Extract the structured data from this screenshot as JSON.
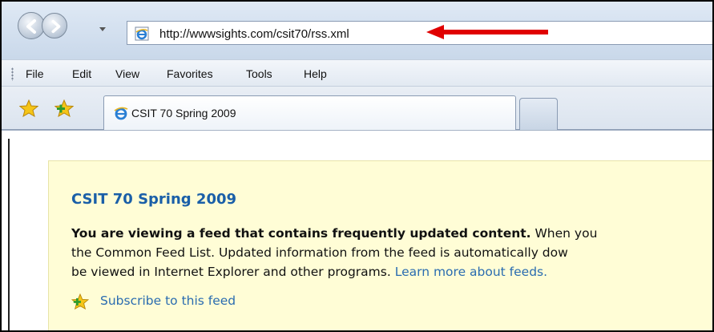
{
  "address_bar": {
    "url": "http://wwwsights.com/csit70/rss.xml"
  },
  "menu": {
    "items": [
      "File",
      "Edit",
      "View",
      "Favorites",
      "Tools",
      "Help"
    ]
  },
  "tabs": {
    "active_label": "CSIT 70 Spring 2009"
  },
  "feed": {
    "title": "CSIT 70 Spring 2009",
    "intro_bold": "You are viewing a feed that contains frequently updated content.",
    "intro_rest_line1": " When you",
    "line2": "the Common Feed List. Updated information from the feed is automatically dow",
    "line3_prefix": "be viewed in Internet Explorer and other programs. ",
    "learn_more": "Learn more about feeds.",
    "subscribe": "Subscribe to this feed"
  },
  "colors": {
    "annotation_arrow": "#e00000",
    "feed_background": "#fffdd6",
    "link": "#2a6cb0",
    "feed_title": "#1a5fa8"
  },
  "icons": {
    "back": "back-arrow-icon",
    "forward": "forward-arrow-icon",
    "page": "ie-page-icon",
    "favorites": "favorites-star-icon",
    "add_favorites": "add-to-favorites-icon",
    "subscribe": "subscribe-feed-icon"
  }
}
